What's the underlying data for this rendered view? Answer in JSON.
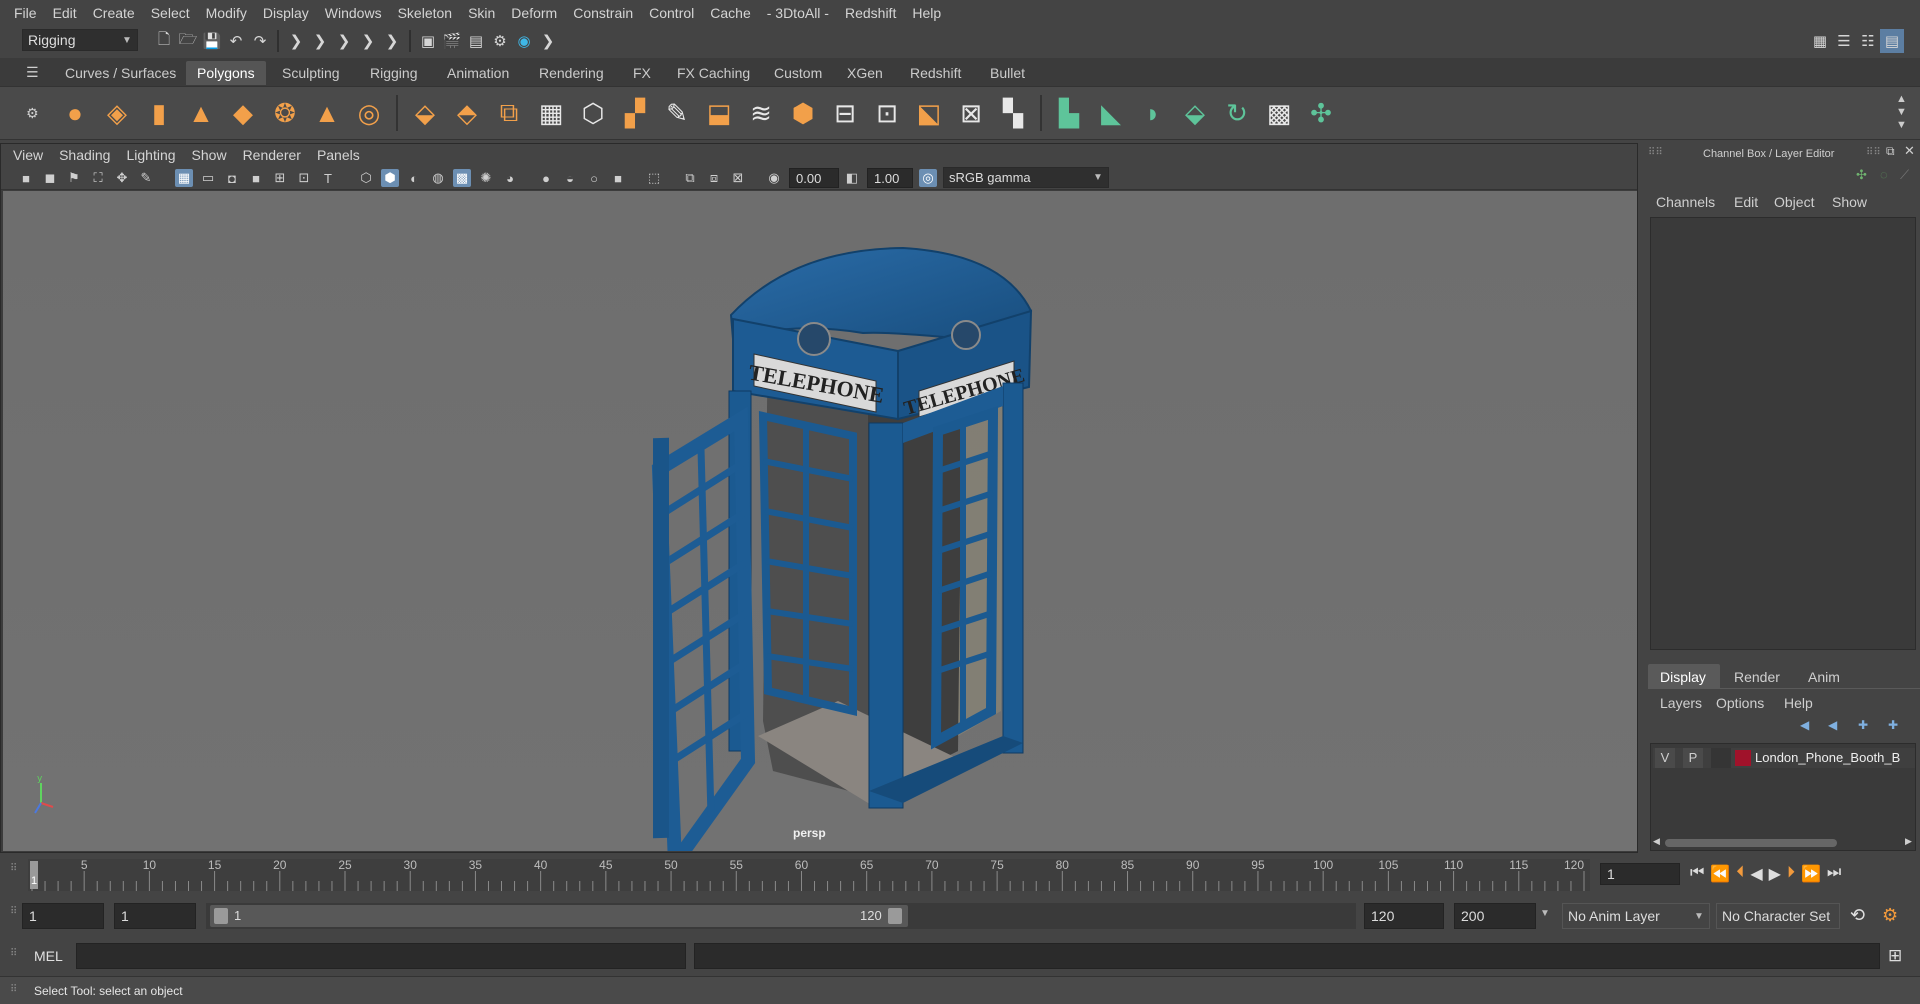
{
  "menubar": [
    "File",
    "Edit",
    "Create",
    "Select",
    "Modify",
    "Display",
    "Windows",
    "Skeleton",
    "Skin",
    "Deform",
    "Constrain",
    "Control",
    "Cache",
    "- 3DtoAll -",
    "Redshift",
    "Help"
  ],
  "status_line": {
    "menu_set": "Rigging"
  },
  "shelf_tabs": [
    "Curves / Surfaces",
    "Polygons",
    "Sculpting",
    "Rigging",
    "Animation",
    "Rendering",
    "FX",
    "FX Caching",
    "Custom",
    "XGen",
    "Redshift",
    "Bullet"
  ],
  "active_shelf_tab": "Polygons",
  "panel_menu": [
    "View",
    "Shading",
    "Lighting",
    "Show",
    "Renderer",
    "Panels"
  ],
  "panel_toolbar": {
    "exposure": "0.00",
    "gamma": "1.00",
    "color_space": "sRGB gamma"
  },
  "viewport": {
    "camera_label": "persp",
    "sign_left": "TELEPHONE",
    "sign_right": "TELEPHONE",
    "booth_color": "#1f5a8c",
    "background_color": "#707070"
  },
  "channel_box": {
    "title": "Channel Box / Layer Editor",
    "menu": [
      "Channels",
      "Edit",
      "Object",
      "Show"
    ]
  },
  "layer_editor": {
    "tabs": [
      "Display",
      "Render",
      "Anim"
    ],
    "active_tab": "Display",
    "menu": [
      "Layers",
      "Options",
      "Help"
    ],
    "layers": [
      {
        "visible": "V",
        "playback": "P",
        "color": "#a0122a",
        "name": "London_Phone_Booth_B"
      }
    ]
  },
  "time_slider": {
    "ticks": [
      "5",
      "10",
      "15",
      "20",
      "25",
      "30",
      "35",
      "40",
      "45",
      "50",
      "55",
      "60",
      "65",
      "70",
      "75",
      "80",
      "85",
      "90",
      "95",
      "100",
      "105",
      "110",
      "115",
      "120"
    ],
    "first_frame": "1",
    "current_frame": "1"
  },
  "range_slider": {
    "start_time": "1",
    "playback_start": "1",
    "range_start": "1",
    "range_end": "120",
    "playback_end": "120",
    "end_time": "200",
    "anim_layer": "No Anim Layer",
    "character_set": "No Character Set"
  },
  "command_line": {
    "language": "MEL"
  },
  "help_line": "Select Tool: select an object"
}
